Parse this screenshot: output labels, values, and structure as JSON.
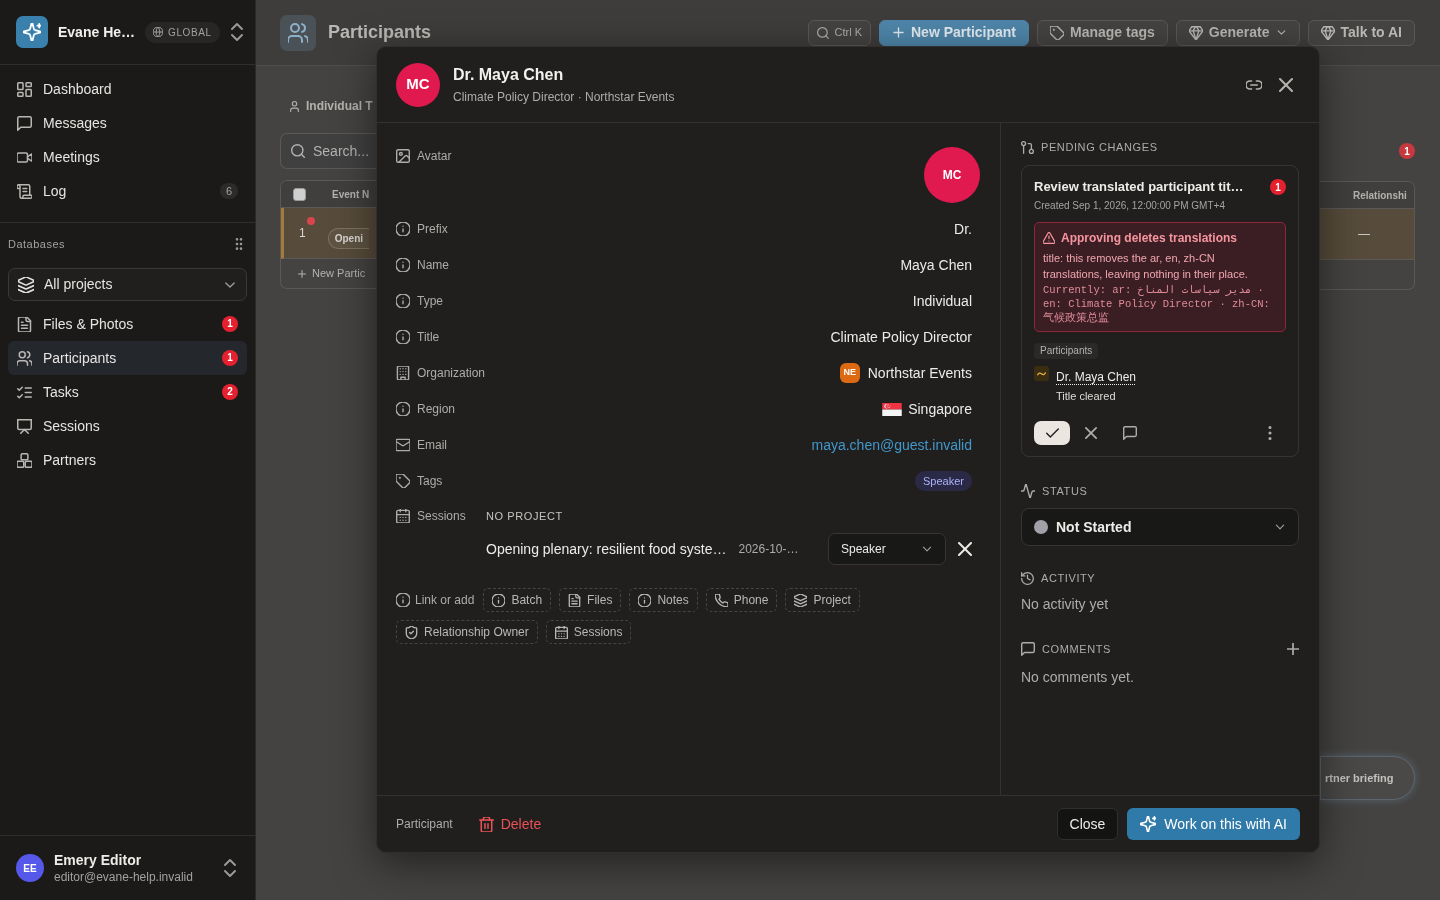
{
  "sidebar": {
    "workspace": {
      "name": "Evane He…",
      "scope": "GLOBAL"
    },
    "nav": [
      {
        "label": "Dashboard",
        "selected": false
      },
      {
        "label": "Messages",
        "selected": false
      },
      {
        "label": "Meetings",
        "selected": false
      },
      {
        "label": "Log",
        "badge": "6",
        "selected": false
      }
    ],
    "section_title": "Databases",
    "project_filter": "All projects",
    "databases": [
      {
        "label": "Files & Photos",
        "badge": "1",
        "selected": false
      },
      {
        "label": "Participants",
        "badge": "1",
        "selected": true
      },
      {
        "label": "Tasks",
        "badge": "2",
        "selected": false
      },
      {
        "label": "Sessions",
        "selected": false
      },
      {
        "label": "Partners",
        "selected": false
      }
    ],
    "user": {
      "initials": "EE",
      "name": "Emery Editor",
      "email": "editor@evane-help.invalid"
    }
  },
  "page": {
    "title": "Participants",
    "toolbar": [
      {
        "kind": "search",
        "label": "Ctrl K"
      },
      {
        "kind": "primary",
        "label": "New Participant"
      },
      {
        "kind": "tags",
        "label": "Manage tags"
      },
      {
        "kind": "menu",
        "label": "Generate"
      },
      {
        "kind": "ai",
        "label": "Talk to AI"
      }
    ],
    "view": "Individual T",
    "search": {
      "placeholder": "Search..."
    },
    "pending_count": "1",
    "table": {
      "select_all": {
        "checked": false
      },
      "columns": [
        "Event N",
        "Relationshi"
      ],
      "rows": [
        {
          "number": "1",
          "event": "Openi",
          "relationship": "—",
          "selected": true
        }
      ],
      "add_row": "New Partic"
    },
    "floating_button": "rtner briefing"
  },
  "dialog": {
    "avatar_initials": "MC",
    "title": "Dr. Maya Chen",
    "subtitle": "Climate Policy Director · Northstar Events",
    "fields": [
      {
        "kind": "avatar",
        "label": "Avatar",
        "value": "MC"
      },
      {
        "kind": "text",
        "label": "Prefix",
        "value": "Dr."
      },
      {
        "kind": "text",
        "label": "Name",
        "value": "Maya Chen"
      },
      {
        "kind": "text",
        "label": "Type",
        "value": "Individual"
      },
      {
        "kind": "text",
        "label": "Title",
        "value": "Climate Policy Director"
      },
      {
        "kind": "organization",
        "label": "Organization",
        "badge": "NE",
        "value": "Northstar Events"
      },
      {
        "kind": "region",
        "label": "Region",
        "value": "Singapore"
      },
      {
        "kind": "email",
        "label": "Email",
        "value": "maya.chen@guest.invalid"
      },
      {
        "kind": "tags",
        "label": "Tags",
        "tags": [
          "Speaker"
        ]
      },
      {
        "kind": "sessions",
        "label": "Sessions",
        "group": "NO PROJECT",
        "sessions": [
          {
            "title": "Opening plenary: resilient food syste…",
            "date": "2026-10-…",
            "role": "Speaker"
          }
        ]
      }
    ],
    "link_or_add": {
      "label": "Link or add",
      "chips": [
        "Batch",
        "Files",
        "Notes",
        "Phone",
        "Project",
        "Relationship Owner",
        "Sessions"
      ]
    },
    "side_panel": {
      "pending": {
        "heading": "PENDING CHANGES",
        "items": [
          {
            "title": "Review translated participant tit…",
            "count": "1",
            "created": "Created Sep 1, 2026, 12:00:00 PM GMT+4",
            "warning": {
              "title": "Approving deletes translations",
              "body": "title: this removes the ar, en, zh-CN translations, leaving nothing in their place.",
              "current": "Currently: ar: مدير سياسات المناخ · en: Climate Policy Director · zh-CN: 气候政策总监"
            },
            "group": "Participants",
            "target": "Dr. Maya Chen",
            "change": "Title cleared"
          }
        ]
      },
      "status": {
        "heading": "STATUS",
        "value": "Not Started",
        "color": "#a1a1aa"
      },
      "activity": {
        "heading": "ACTIVITY",
        "empty": "No activity yet"
      },
      "comments": {
        "heading": "COMMENTS",
        "empty": "No comments yet."
      }
    },
    "footer": {
      "entity": "Participant",
      "delete": "Delete",
      "close": "Close",
      "primary": "Work on this with AI"
    }
  }
}
